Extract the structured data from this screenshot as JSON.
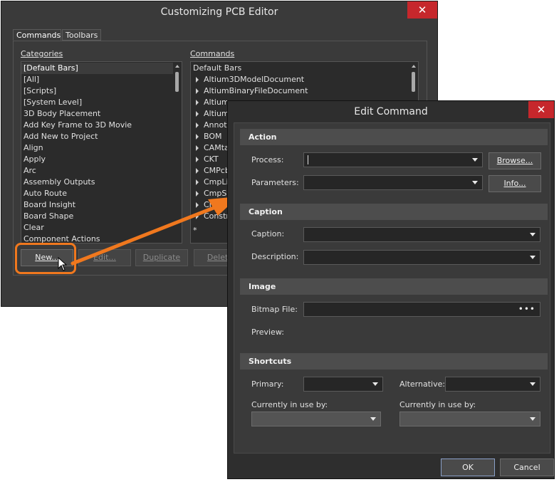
{
  "customizing": {
    "title": "Customizing PCB Editor",
    "close_glyph": "✕",
    "tabs": [
      {
        "label": "Commands"
      },
      {
        "label": "Toolbars"
      }
    ],
    "categories_label": "Categories",
    "commands_label": "Commands",
    "categories": [
      "[Default Bars]",
      "[All]",
      "[Scripts]",
      "[System Level]",
      "3D Body Placement",
      "Add Key Frame to 3D Movie",
      "Add New to Project",
      "Align",
      "Apply",
      "Arc",
      "Assembly Outputs",
      "Auto Route",
      "Board Insight",
      "Board Shape",
      "Clear",
      "Component Actions"
    ],
    "commands_header": "Default Bars",
    "commands": [
      "Altium3DModelDocument",
      "AltiumBinaryFileDocument",
      "Altium",
      "Altium",
      "Annot",
      "BOM",
      "CAMta",
      "CKT",
      "CMPcb",
      "CmpLib",
      "CmpSy",
      "CM",
      "Constr"
    ],
    "commands_asterisk": "*",
    "buttons": {
      "new": "New...",
      "edit": "Edit...",
      "duplicate": "Duplicate",
      "delete": "Delete"
    }
  },
  "edit_command": {
    "title": "Edit Command",
    "close_glyph": "✕",
    "sections": {
      "action": "Action",
      "caption": "Caption",
      "image": "Image",
      "shortcuts": "Shortcuts"
    },
    "labels": {
      "process": "Process:",
      "parameters": "Parameters:",
      "caption": "Caption:",
      "description": "Description:",
      "bitmap_file": "Bitmap File:",
      "preview": "Preview:",
      "primary": "Primary:",
      "alternative": "Alternative:",
      "in_use_primary": "Currently in use by:",
      "in_use_alt": "Currently in use by:"
    },
    "values": {
      "process": "",
      "parameters": "",
      "caption": "",
      "description": "",
      "bitmap_file": ""
    },
    "buttons": {
      "browse": "Browse...",
      "info": "Info...",
      "ok": "OK",
      "cancel": "Cancel"
    },
    "bitmap_dots": "•••"
  },
  "colors": {
    "accent_arrow": "#f0781e",
    "close_red": "#c6272c"
  }
}
